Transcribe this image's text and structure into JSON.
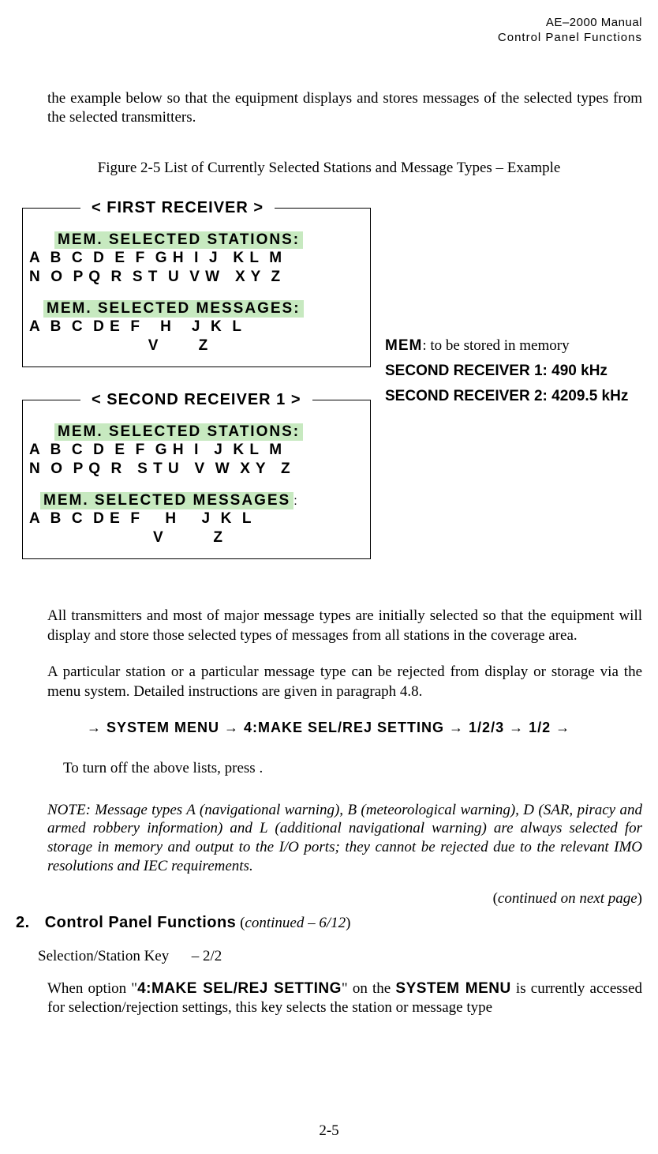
{
  "header": {
    "line1": "AE–2000 Manual",
    "line2": "Control Panel Functions"
  },
  "intro_para": "the example below so that the equipment displays and stores messages of the selected types from the selected transmitters.",
  "figure": {
    "caption": "Figure 2-5   List of Currently Selected Stations and Message Types – Example",
    "receiver1": {
      "title": "< FIRST RECEIVER >",
      "stations_header": "MEM. SELECTED STATIONS:",
      "stations_lines": "A  B  C  D  E  F  G H  I  J   K L  M\nN  O  P Q  R  S T  U  V W   X Y  Z",
      "messages_header": "MEM. SELECTED MESSAGES:",
      "messages_lines": "A  B  C  D E  F    H    J  K  L\n                        V        Z"
    },
    "receiver2": {
      "title": "< SECOND RECEIVER 1 >",
      "stations_header": "MEM. SELECTED STATIONS:",
      "stations_lines": "A  B  C  D  E  F  G H  I   J  K L  M\nN  O  P Q  R   S T U   V  W  X Y   Z",
      "messages_header": "MEM.    SELECTED MESSAGES",
      "messages_lines": "A  B  C  D E  F     H     J  K  L\n                         V          Z"
    },
    "legend": {
      "mem_label": "MEM",
      "mem_desc": ": to be stored in memory",
      "sr1_label": "SECOND RECEIVER 1",
      "sr1_val": ": 490 kHz",
      "sr2_label": "SECOND RECEIVER 2",
      "sr2_val": ": 4209.5 kHz"
    }
  },
  "para_all": "All transmitters and most of major message types are initially selected so that the equipment will display and store those selected types of messages from all stations in the coverage area.",
  "para_reject": "A particular station or a particular message type can be rejected from display or storage via the menu system. Detailed instructions are given in paragraph 4.8.",
  "menu_path": "→ SYSTEM MENU → 4:MAKE SEL/REJ SETTING → 1/2/3 → 1/2 →",
  "turnoff": "To turn off the above lists, press       .",
  "note": "NOTE: Message types A (navigational warning), B (meteorological warning), D (SAR, piracy and armed robbery information) and L (additional navigational warning) are always selected for storage in memory and output to the I/O ports; they cannot be rejected due to the relevant IMO resolutions and IEC requirements.",
  "continued_next": "continued on next page",
  "section": {
    "num": "2.",
    "title": "Control Panel Functions",
    "cont": "continued – 6/12"
  },
  "subkey": {
    "label": "Selection/Station Key",
    "suffix": "– 2/2"
  },
  "when_para_pre": "When option \"",
  "when_para_opt": "4:MAKE SEL/REJ SETTING",
  "when_para_mid": "\" on the ",
  "when_para_menu": "SYSTEM MENU",
  "when_para_post": " is currently accessed for selection/rejection settings, this key selects the station or message type",
  "page_num": "2-5"
}
